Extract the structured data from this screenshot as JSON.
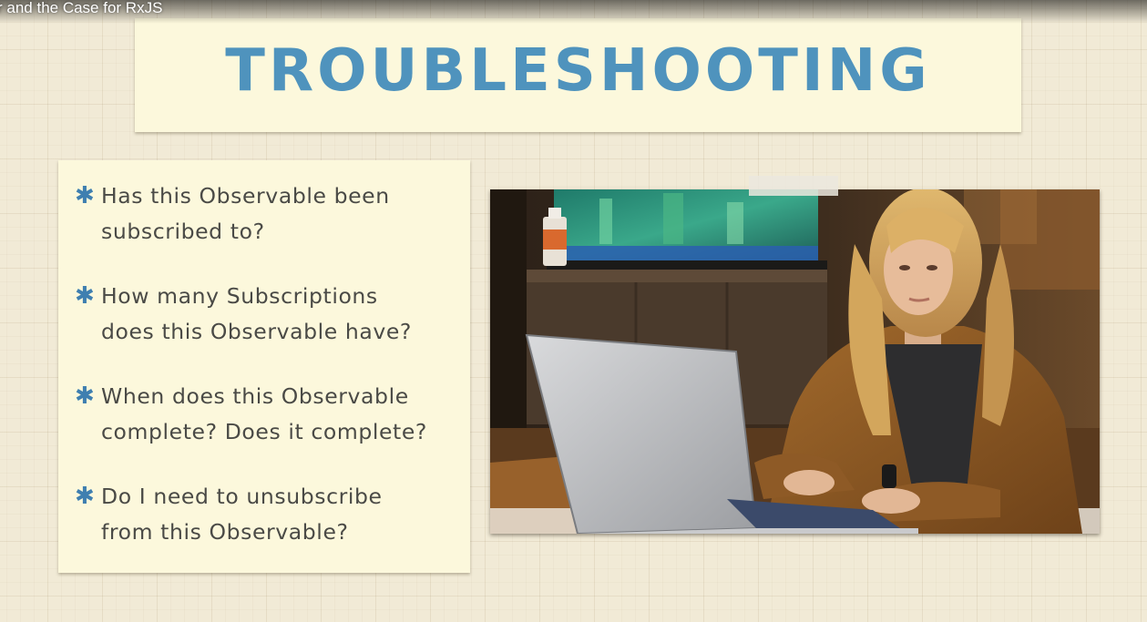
{
  "video": {
    "title": "r and the Case for RxJS"
  },
  "slide": {
    "heading": "TROUBLESHOOTING",
    "bullets": [
      {
        "line1": "Has this Observable been",
        "line2": "subscribed to?"
      },
      {
        "line1": "How many Subscriptions",
        "line2": "does this Observable have?"
      },
      {
        "line1": "When does this Observable",
        "line2": "complete? Does it complete?"
      },
      {
        "line1": "Do I need to unsubscribe",
        "line2": "from this Observable?"
      }
    ],
    "bullet_marker": "✱",
    "photo_icon": "woman-at-laptop-photo"
  },
  "colors": {
    "heading": "#4f93bd",
    "bullet_marker": "#3f7fb0",
    "card": "#fcf8dc",
    "background": "#f1ead6",
    "text": "#4a4a46"
  }
}
